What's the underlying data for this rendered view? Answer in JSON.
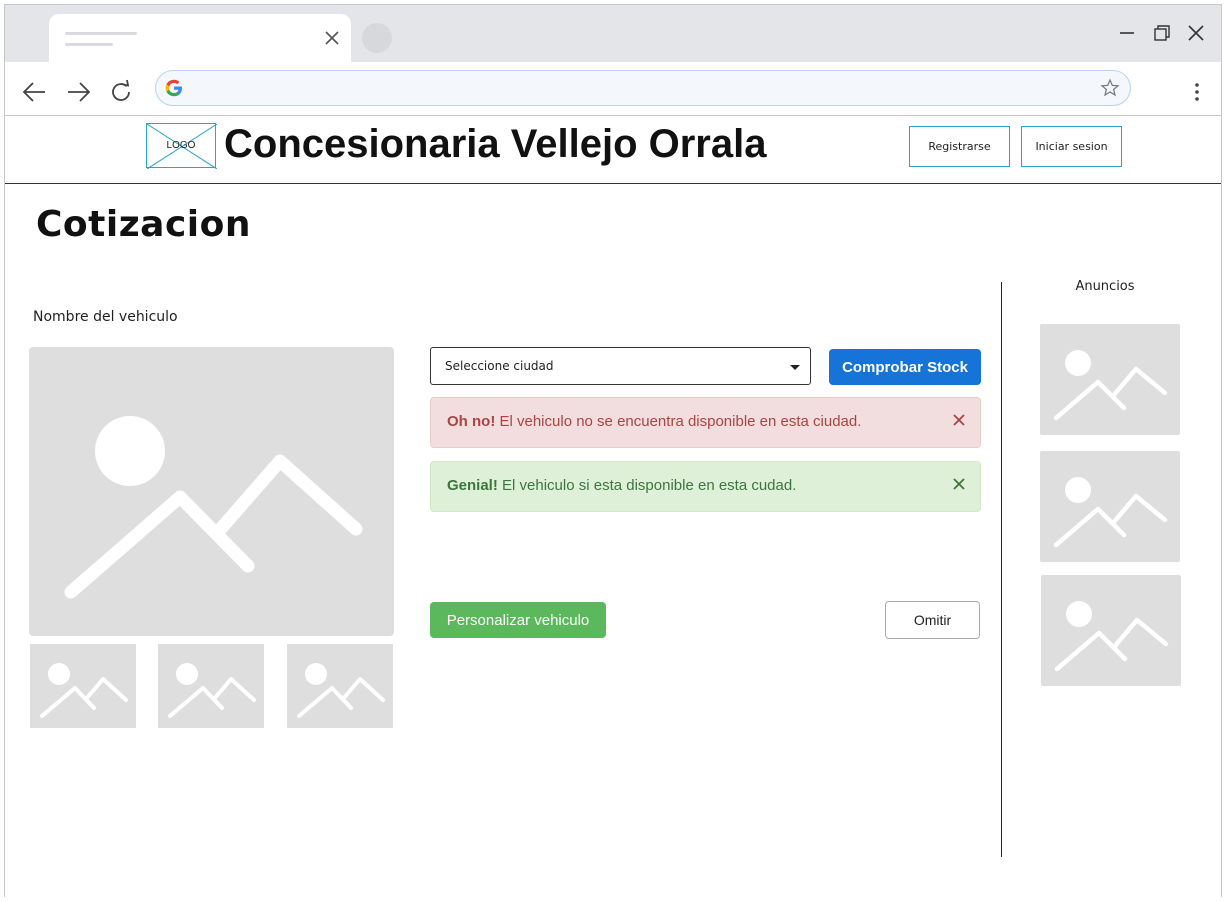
{
  "header": {
    "logo_text": "LOGO",
    "site_title": "Concesionaria Vellejo Orrala",
    "register_label": "Registrarse",
    "login_label": "Iniciar sesion"
  },
  "main": {
    "page_title": "Cotizacion",
    "vehicle_name": "Nombre del vehiculo",
    "city_select": "Seleccione ciudad",
    "check_stock_label": "Comprobar Stock",
    "alert_danger": {
      "strong": "Oh no!",
      "text": " El vehiculo no se encuentra disponible en esta ciudad."
    },
    "alert_success": {
      "strong": "Genial!",
      "text": " El vehiculo si esta disponible en esta cudad."
    },
    "customize_label": "Personalizar vehiculo",
    "omit_label": "Omitir"
  },
  "sidebar": {
    "ads_title": "Anuncios"
  },
  "colors": {
    "primary": "#1673d8",
    "success": "#5cb85c",
    "danger_bg": "#f2dede",
    "success_bg": "#dff0d8",
    "placeholder": "#dedede",
    "logo_border": "#2aa3cf"
  }
}
